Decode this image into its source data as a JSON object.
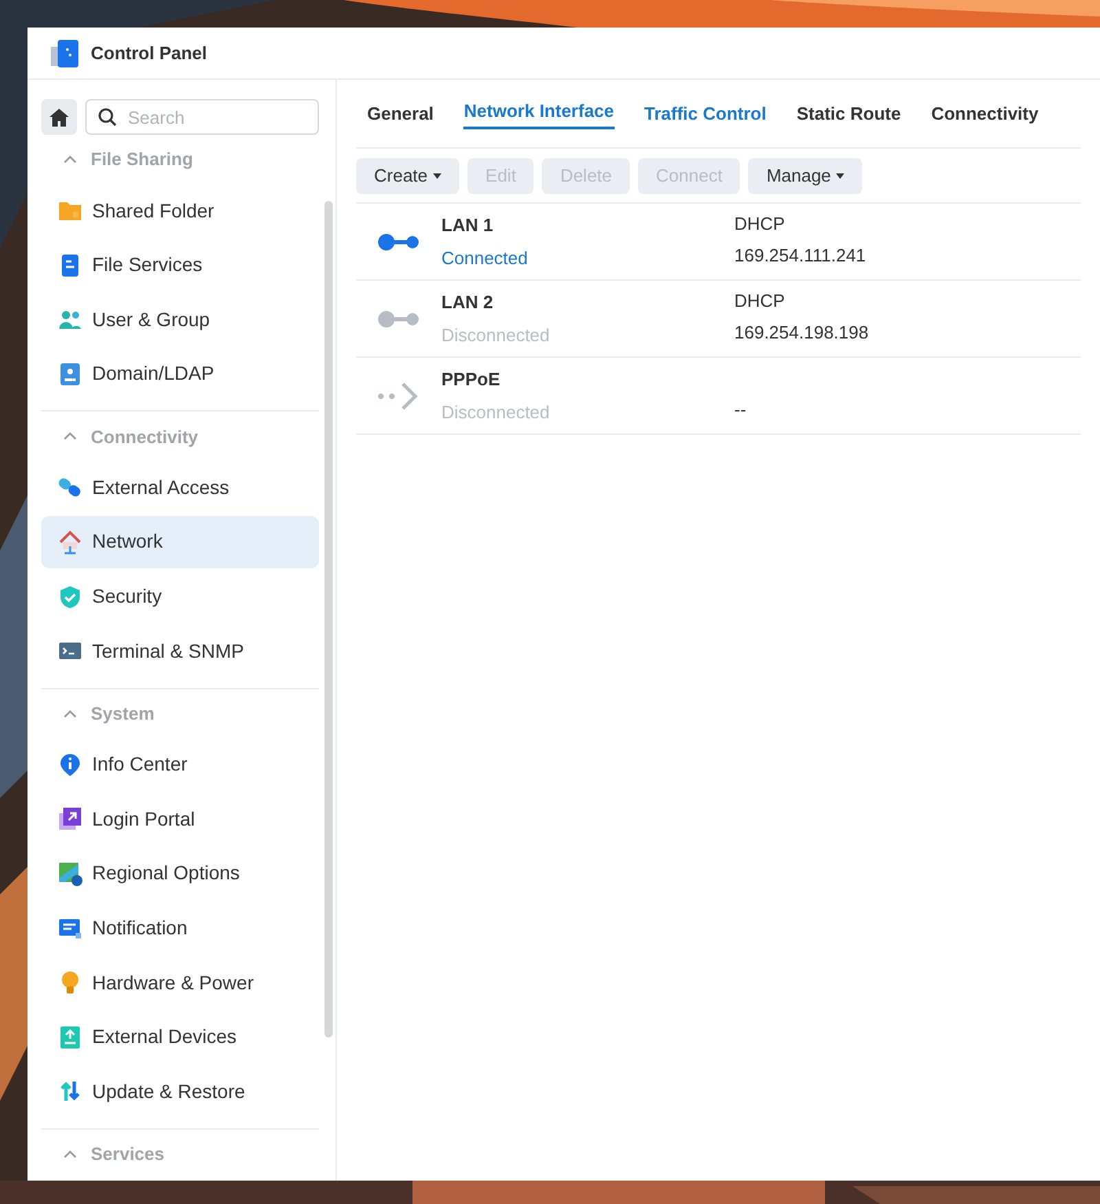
{
  "window": {
    "title": "Control Panel"
  },
  "sidebar": {
    "search": {
      "placeholder": "Search"
    },
    "sections": [
      {
        "title": "File Sharing",
        "expanded": true,
        "items": [
          {
            "label": "Shared Folder",
            "selected": false
          },
          {
            "label": "File Services",
            "selected": false
          },
          {
            "label": "User & Group",
            "selected": false
          },
          {
            "label": "Domain/LDAP",
            "selected": false
          }
        ]
      },
      {
        "title": "Connectivity",
        "expanded": true,
        "items": [
          {
            "label": "External Access",
            "selected": false
          },
          {
            "label": "Network",
            "selected": true
          },
          {
            "label": "Security",
            "selected": false
          },
          {
            "label": "Terminal & SNMP",
            "selected": false
          }
        ]
      },
      {
        "title": "System",
        "expanded": true,
        "items": [
          {
            "label": "Info Center",
            "selected": false
          },
          {
            "label": "Login Portal",
            "selected": false
          },
          {
            "label": "Regional Options",
            "selected": false
          },
          {
            "label": "Notification",
            "selected": false
          },
          {
            "label": "Hardware & Power",
            "selected": false
          },
          {
            "label": "External Devices",
            "selected": false
          },
          {
            "label": "Update & Restore",
            "selected": false
          }
        ]
      },
      {
        "title": "Services",
        "expanded": true
      }
    ]
  },
  "tabs": [
    {
      "label": "General",
      "selected": false,
      "hovered": false
    },
    {
      "label": "Network Interface",
      "selected": true,
      "hovered": false
    },
    {
      "label": "Traffic Control",
      "selected": false,
      "hovered": true
    },
    {
      "label": "Static Route",
      "selected": false,
      "hovered": false
    },
    {
      "label": "Connectivity",
      "selected": false,
      "hovered": false
    }
  ],
  "toolbar": [
    {
      "label": "Create",
      "disabled": false,
      "dropdown": true
    },
    {
      "label": "Edit",
      "disabled": true,
      "dropdown": false
    },
    {
      "label": "Delete",
      "disabled": true,
      "dropdown": false
    },
    {
      "label": "Connect",
      "disabled": true,
      "dropdown": false
    },
    {
      "label": "Manage",
      "disabled": false,
      "dropdown": true
    }
  ],
  "interfaces": [
    {
      "kind": "lan",
      "name": "LAN 1",
      "status": "Connected",
      "connected": true,
      "mode": "DHCP",
      "address": "169.254.111.241"
    },
    {
      "kind": "lan",
      "name": "LAN 2",
      "status": "Disconnected",
      "connected": false,
      "mode": "DHCP",
      "address": "169.254.198.198"
    },
    {
      "kind": "pppoe",
      "name": "PPPoE",
      "status": "Disconnected",
      "connected": false,
      "address": "--"
    }
  ]
}
